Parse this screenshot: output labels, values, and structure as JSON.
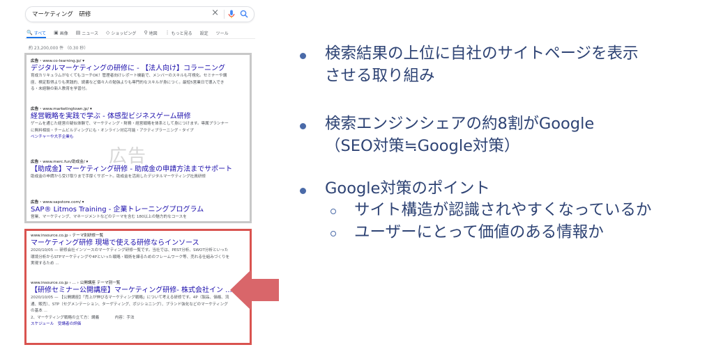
{
  "search": {
    "query": "マーケティング　研修"
  },
  "tabs": [
    {
      "icon": "search",
      "label": "すべて"
    },
    {
      "icon": "image",
      "label": "画像"
    },
    {
      "icon": "news",
      "label": "ニュース"
    },
    {
      "icon": "tag",
      "label": "ショッピング"
    },
    {
      "icon": "pin",
      "label": "地図"
    },
    {
      "icon": "more",
      "label": "もっと見る"
    },
    {
      "icon": "",
      "label": "設定"
    },
    {
      "icon": "",
      "label": "ツール"
    }
  ],
  "result_count": "約 23,200,000 件 （0.30 秒）",
  "ads": [
    {
      "label": "広告 · ",
      "url": "www.co-learning.jp/",
      "title": "デジタルマーケティングの研修に - 【法人向け】コラーニング",
      "desc": "育成カリキュラムがなくてもコーチOK！管理者向けレポート機能で、メンバーのスキルも可視化。セミナーや講座、検定取得よりも実践的、読書など個々人の勉強よりも専門的なスキルが身につく。最短5営業日で導入できる・未経験の新人教育を学習付。"
    },
    {
      "label": "広告 · ",
      "url": "www.marketingtown.jp/",
      "title": "経営戦略を実践で学ぶ - 体感型ビジネスゲーム研修",
      "desc": "ゲームを通じた経営の疑似体験で、マーケティング・財務・経営戦略を体系として身につけます。専属プランナーに無料相談・チームビルディングにも・オンライン対応可能・アクティブラーニング・タイプ",
      "sub": "ベンチャーや大手企業も"
    },
    {
      "label": "広告 · ",
      "url": "www.merc.fun/助成金/",
      "title": "【助成金】マーケティング研修 - 助成金の申請方法までサポート",
      "desc": "助成金の申請から受け取りまで手厚くサポート。助成金を活用したデジタルマーケティング社員研修"
    },
    {
      "label": "広告 · ",
      "url": "www.sapstore.com/",
      "title": "SAP® Litmos Training - 企業トレーニングプログラム",
      "desc": "営業、マーケティング、マネージメントなどのテーマを含む 180以上の魅力的なコースを"
    }
  ],
  "ad_watermark": "広告",
  "organic": [
    {
      "url": "www.insource.co.jp › テーマ別研修一覧",
      "title": "マーケティング研修 現場で使える研修ならインソース",
      "desc": "2020/10/05 — 研修会社インソースのマーケティング研修一覧です。当社では、PEST分析、SWOT分析といった環境分析からSTPマーケティングや4Pといった戦略・戦術を練るためのフレームワーク等、売れる仕組みづくりを実現するため ..."
    },
    {
      "url": "www.insource.co.jp › ... › 公開講座 テーマ別一覧",
      "title": "【研修セミナー公開講座】マーケティング研修- 株式会社イン ...",
      "desc": "2020/10/05 — 【公開講座】「売上が伸びるマーケティング戦略」について考える研修です。4P（製品、価格、流通、販売）、STP（セグメンテーション、ターゲティング、ポジショニング）、ブランド強化などのマーケティングの基本 ...",
      "extra1": "2、マーケティング戦略の立て方：講義",
      "extra2": "内容：手法",
      "links": [
        "スケジュール",
        "受講者の評価"
      ]
    }
  ],
  "bullets": [
    {
      "lines": [
        "検索結果の上位に自社のサイトページを表示",
        "させる取り組み"
      ]
    },
    {
      "lines": [
        "検索エンジンシェアの約8割がGoogle",
        "（SEO対策≒Google対策）"
      ]
    },
    {
      "lines": [
        "Google対策のポイント"
      ]
    }
  ],
  "sub_bullets": [
    "サイト構造が認識されやすくなっているか",
    "ユーザーにとって価値のある情報か"
  ],
  "colors": {
    "accent_blue": "#1a73e8",
    "link": "#1a0dab",
    "highlight_red": "#d9534f",
    "arrow": "#d9666a",
    "text_navy": "#2e4374"
  }
}
